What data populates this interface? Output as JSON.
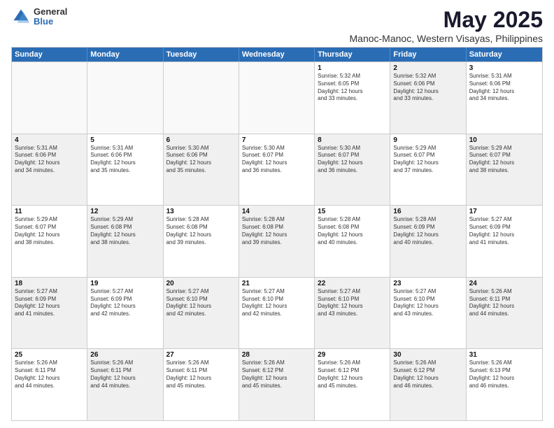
{
  "logo": {
    "general": "General",
    "blue": "Blue"
  },
  "title": "May 2025",
  "subtitle": "Manoc-Manoc, Western Visayas, Philippines",
  "header_days": [
    "Sunday",
    "Monday",
    "Tuesday",
    "Wednesday",
    "Thursday",
    "Friday",
    "Saturday"
  ],
  "weeks": [
    [
      {
        "day": "",
        "info": "",
        "empty": true
      },
      {
        "day": "",
        "info": "",
        "empty": true
      },
      {
        "day": "",
        "info": "",
        "empty": true
      },
      {
        "day": "",
        "info": "",
        "empty": true
      },
      {
        "day": "1",
        "info": "Sunrise: 5:32 AM\nSunset: 6:05 PM\nDaylight: 12 hours\nand 33 minutes.",
        "shaded": false
      },
      {
        "day": "2",
        "info": "Sunrise: 5:32 AM\nSunset: 6:06 PM\nDaylight: 12 hours\nand 33 minutes.",
        "shaded": true
      },
      {
        "day": "3",
        "info": "Sunrise: 5:31 AM\nSunset: 6:06 PM\nDaylight: 12 hours\nand 34 minutes.",
        "shaded": false
      }
    ],
    [
      {
        "day": "4",
        "info": "Sunrise: 5:31 AM\nSunset: 6:06 PM\nDaylight: 12 hours\nand 34 minutes.",
        "shaded": true
      },
      {
        "day": "5",
        "info": "Sunrise: 5:31 AM\nSunset: 6:06 PM\nDaylight: 12 hours\nand 35 minutes.",
        "shaded": false
      },
      {
        "day": "6",
        "info": "Sunrise: 5:30 AM\nSunset: 6:06 PM\nDaylight: 12 hours\nand 35 minutes.",
        "shaded": true
      },
      {
        "day": "7",
        "info": "Sunrise: 5:30 AM\nSunset: 6:07 PM\nDaylight: 12 hours\nand 36 minutes.",
        "shaded": false
      },
      {
        "day": "8",
        "info": "Sunrise: 5:30 AM\nSunset: 6:07 PM\nDaylight: 12 hours\nand 36 minutes.",
        "shaded": true
      },
      {
        "day": "9",
        "info": "Sunrise: 5:29 AM\nSunset: 6:07 PM\nDaylight: 12 hours\nand 37 minutes.",
        "shaded": false
      },
      {
        "day": "10",
        "info": "Sunrise: 5:29 AM\nSunset: 6:07 PM\nDaylight: 12 hours\nand 38 minutes.",
        "shaded": true
      }
    ],
    [
      {
        "day": "11",
        "info": "Sunrise: 5:29 AM\nSunset: 6:07 PM\nDaylight: 12 hours\nand 38 minutes.",
        "shaded": false
      },
      {
        "day": "12",
        "info": "Sunrise: 5:29 AM\nSunset: 6:08 PM\nDaylight: 12 hours\nand 38 minutes.",
        "shaded": true
      },
      {
        "day": "13",
        "info": "Sunrise: 5:28 AM\nSunset: 6:08 PM\nDaylight: 12 hours\nand 39 minutes.",
        "shaded": false
      },
      {
        "day": "14",
        "info": "Sunrise: 5:28 AM\nSunset: 6:08 PM\nDaylight: 12 hours\nand 39 minutes.",
        "shaded": true
      },
      {
        "day": "15",
        "info": "Sunrise: 5:28 AM\nSunset: 6:08 PM\nDaylight: 12 hours\nand 40 minutes.",
        "shaded": false
      },
      {
        "day": "16",
        "info": "Sunrise: 5:28 AM\nSunset: 6:09 PM\nDaylight: 12 hours\nand 40 minutes.",
        "shaded": true
      },
      {
        "day": "17",
        "info": "Sunrise: 5:27 AM\nSunset: 6:09 PM\nDaylight: 12 hours\nand 41 minutes.",
        "shaded": false
      }
    ],
    [
      {
        "day": "18",
        "info": "Sunrise: 5:27 AM\nSunset: 6:09 PM\nDaylight: 12 hours\nand 41 minutes.",
        "shaded": true
      },
      {
        "day": "19",
        "info": "Sunrise: 5:27 AM\nSunset: 6:09 PM\nDaylight: 12 hours\nand 42 minutes.",
        "shaded": false
      },
      {
        "day": "20",
        "info": "Sunrise: 5:27 AM\nSunset: 6:10 PM\nDaylight: 12 hours\nand 42 minutes.",
        "shaded": true
      },
      {
        "day": "21",
        "info": "Sunrise: 5:27 AM\nSunset: 6:10 PM\nDaylight: 12 hours\nand 42 minutes.",
        "shaded": false
      },
      {
        "day": "22",
        "info": "Sunrise: 5:27 AM\nSunset: 6:10 PM\nDaylight: 12 hours\nand 43 minutes.",
        "shaded": true
      },
      {
        "day": "23",
        "info": "Sunrise: 5:27 AM\nSunset: 6:10 PM\nDaylight: 12 hours\nand 43 minutes.",
        "shaded": false
      },
      {
        "day": "24",
        "info": "Sunrise: 5:26 AM\nSunset: 6:11 PM\nDaylight: 12 hours\nand 44 minutes.",
        "shaded": true
      }
    ],
    [
      {
        "day": "25",
        "info": "Sunrise: 5:26 AM\nSunset: 6:11 PM\nDaylight: 12 hours\nand 44 minutes.",
        "shaded": false
      },
      {
        "day": "26",
        "info": "Sunrise: 5:26 AM\nSunset: 6:11 PM\nDaylight: 12 hours\nand 44 minutes.",
        "shaded": true
      },
      {
        "day": "27",
        "info": "Sunrise: 5:26 AM\nSunset: 6:11 PM\nDaylight: 12 hours\nand 45 minutes.",
        "shaded": false
      },
      {
        "day": "28",
        "info": "Sunrise: 5:26 AM\nSunset: 6:12 PM\nDaylight: 12 hours\nand 45 minutes.",
        "shaded": true
      },
      {
        "day": "29",
        "info": "Sunrise: 5:26 AM\nSunset: 6:12 PM\nDaylight: 12 hours\nand 45 minutes.",
        "shaded": false
      },
      {
        "day": "30",
        "info": "Sunrise: 5:26 AM\nSunset: 6:12 PM\nDaylight: 12 hours\nand 46 minutes.",
        "shaded": true
      },
      {
        "day": "31",
        "info": "Sunrise: 5:26 AM\nSunset: 6:13 PM\nDaylight: 12 hours\nand 46 minutes.",
        "shaded": false
      }
    ]
  ]
}
